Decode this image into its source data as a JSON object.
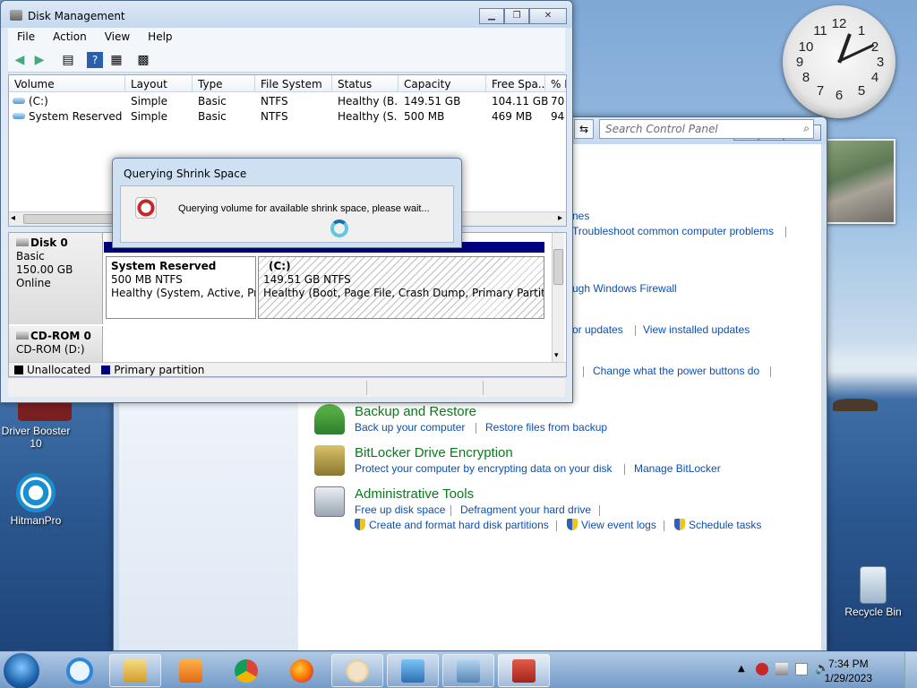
{
  "desktop": {
    "icons": [
      {
        "label": "Driver Booster 10"
      },
      {
        "label": "HitmanPro"
      },
      {
        "label": "Recycle Bin"
      }
    ],
    "clock_gadget": {
      "numbers": [
        "12",
        "1",
        "2",
        "3",
        "4",
        "5",
        "6",
        "7",
        "8",
        "9",
        "10",
        "11"
      ]
    }
  },
  "control_panel": {
    "search_placeholder": "Search Control Panel",
    "partial_links": {
      "l1": "nes",
      "l2": "Troubleshoot common computer problems",
      "l3": "ugh Windows Firewall",
      "l4": "or updates",
      "l5": "View installed updates",
      "l6": "Change what the power buttons do"
    },
    "sections": {
      "backup": {
        "title": "Backup and Restore",
        "links": [
          "Back up your computer",
          "Restore files from backup"
        ]
      },
      "bitlocker": {
        "title": "BitLocker Drive Encryption",
        "links": [
          "Protect your computer by encrypting data on your disk",
          "Manage BitLocker"
        ]
      },
      "admin": {
        "title": "Administrative Tools",
        "links": [
          "Free up disk space",
          "Defragment your hard drive",
          "Create and format hard disk partitions",
          "View event logs",
          "Schedule tasks"
        ]
      }
    }
  },
  "disk_management": {
    "title": "Disk Management",
    "menu": [
      "File",
      "Action",
      "View",
      "Help"
    ],
    "columns": [
      "Volume",
      "Layout",
      "Type",
      "File System",
      "Status",
      "Capacity",
      "Free Spa...",
      "% F"
    ],
    "rows": [
      {
        "volume": "(C:)",
        "layout": "Simple",
        "type": "Basic",
        "fs": "NTFS",
        "status": "Healthy (B...",
        "capacity": "149.51 GB",
        "free": "104.11 GB",
        "pct": "70"
      },
      {
        "volume": "System Reserved",
        "layout": "Simple",
        "type": "Basic",
        "fs": "NTFS",
        "status": "Healthy (S...",
        "capacity": "500 MB",
        "free": "469 MB",
        "pct": "94"
      }
    ],
    "disk0": {
      "name": "Disk 0",
      "type": "Basic",
      "size": "150.00 GB",
      "state": "Online"
    },
    "partitions": {
      "sysres": {
        "name": "System Reserved",
        "size": "500 MB NTFS",
        "status": "Healthy (System, Active, Prim"
      },
      "c": {
        "name": "(C:)",
        "size": "149.51 GB NTFS",
        "status": "Healthy (Boot, Page File, Crash Dump, Primary Partition)"
      }
    },
    "cdrom": {
      "name": "CD-ROM 0",
      "label": "CD-ROM (D:)"
    },
    "legend": {
      "unallocated": "Unallocated",
      "primary": "Primary partition"
    },
    "colors": {
      "primary": "#000080",
      "unallocated": "#000000"
    }
  },
  "dialog": {
    "title": "Querying Shrink Space",
    "message": "Querying volume for available shrink space, please wait..."
  },
  "taskbar": {
    "time": "7:34 PM",
    "date": "1/29/2023"
  }
}
